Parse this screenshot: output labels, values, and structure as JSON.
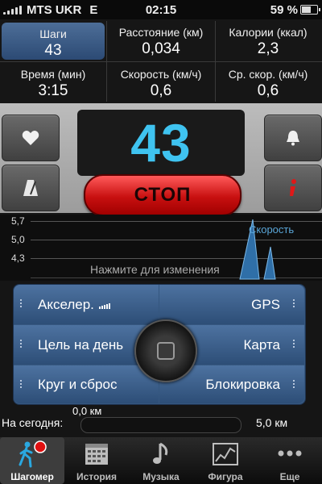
{
  "status_bar": {
    "carrier": "MTS UKR",
    "network": "E",
    "time": "02:15",
    "battery": "59 %",
    "battery_level": 0.59
  },
  "stats": {
    "steps": {
      "label": "Шаги",
      "value": "43"
    },
    "distance": {
      "label": "Расстояние (км)",
      "value": "0,034"
    },
    "calories": {
      "label": "Калории (ккал)",
      "value": "2,3"
    },
    "time": {
      "label": "Время (мин)",
      "value": "3:15"
    },
    "speed": {
      "label": "Скорость (км/ч)",
      "value": "0,6"
    },
    "avg_speed": {
      "label": "Ср. скор. (км/ч)",
      "value": "0,6"
    }
  },
  "counter": {
    "value": "43",
    "color": "#3fc3f0"
  },
  "controls": {
    "stop_label": "СТОП",
    "heart_icon": "heart-icon",
    "metronome_icon": "metronome-icon",
    "bell_icon": "bell-icon",
    "info_icon": "info-icon"
  },
  "graph": {
    "y_ticks": [
      "5,7",
      "5,0",
      "4,3"
    ],
    "series_label": "Скорость",
    "hint": "Нажмите для изменения"
  },
  "menu": {
    "accelerometer": "Акселер.",
    "gps": "GPS",
    "daily_goal": "Цель на день",
    "map": "Карта",
    "lap_reset": "Круг и сброс",
    "lock": "Блокировка"
  },
  "today": {
    "label": "На сегодня:",
    "start": "0,0 км",
    "goal": "5,0 км",
    "progress": 0.0
  },
  "tabs": [
    {
      "label": "Шагомер",
      "icon": "walker-icon",
      "active": true
    },
    {
      "label": "История",
      "icon": "calendar-icon",
      "active": false
    },
    {
      "label": "Музыка",
      "icon": "music-note-icon",
      "active": false
    },
    {
      "label": "Фигура",
      "icon": "chart-icon",
      "active": false
    },
    {
      "label": "Еще",
      "icon": "more-icon",
      "active": false
    }
  ]
}
